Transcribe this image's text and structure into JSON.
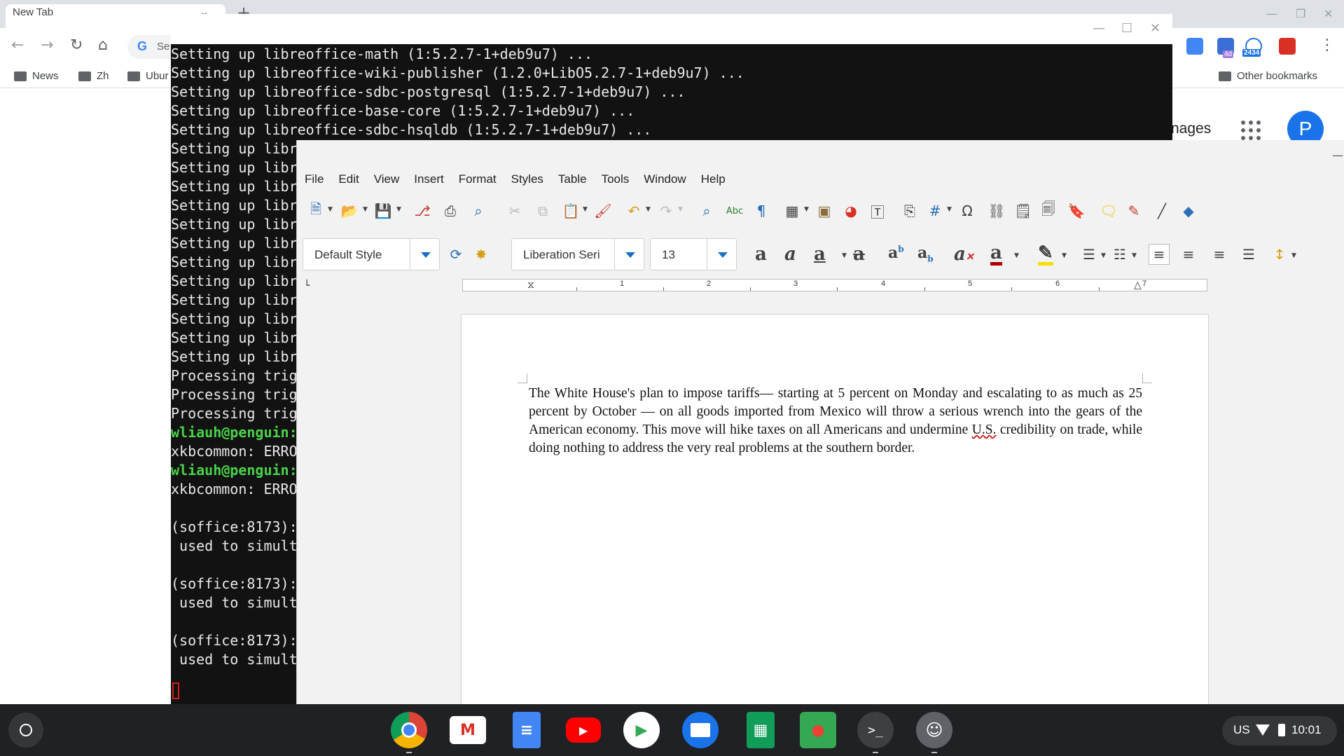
{
  "chrome": {
    "tab_title": "New Tab",
    "tab_close": "⌄",
    "new_tab": "+",
    "omnibox_placeholder": "Se",
    "omnibox_g": "G",
    "ext_badge_1": "4d",
    "ext_badge_2": "2434",
    "bookmarks": [
      "News",
      "Zh",
      "Ubur"
    ],
    "other_bookmarks": "Other bookmarks",
    "images_link": "nages",
    "avatar_letter": "P"
  },
  "terminal": {
    "lines": [
      "Setting up libreoffice-math (1:5.2.7-1+deb9u7) ...",
      "Setting up libreoffice-wiki-publisher (1.2.0+LibO5.2.7-1+deb9u7) ...",
      "Setting up libreoffice-sdbc-postgresql (1:5.2.7-1+deb9u7) ...",
      "Setting up libreoffice-base-core (1:5.2.7-1+deb9u7) ...",
      "Setting up libreoffice-sdbc-hsqldb (1:5.2.7-1+deb9u7) ...",
      "Setting up libre",
      "Setting up libre",
      "Setting up libre",
      "Setting up libre",
      "Setting up libre",
      "Setting up libre",
      "Setting up libre",
      "Setting up libre",
      "Setting up libre",
      "Setting up libre",
      "Setting up libre",
      "Setting up libre",
      "Processing trigg",
      "Processing trigg",
      "Processing trigg"
    ],
    "prompt_1": "wliauh@penguin:",
    "prompt_1_rest": "~",
    "error_1": "xkbcommon: ERROR",
    "prompt_2": "wliauh@penguin:",
    "prompt_2_rest": "~",
    "error_2": "xkbcommon: ERROR",
    "soffice_blocks": [
      {
        "line1": "(soffice:8173):",
        "line2": " used to simulta"
      },
      {
        "line1": "(soffice:8173):",
        "line2": " used to simulta"
      },
      {
        "line1": "(soffice:8173):",
        "line2": " used to simulta"
      }
    ]
  },
  "writer": {
    "menu": [
      "File",
      "Edit",
      "View",
      "Insert",
      "Format",
      "Styles",
      "Table",
      "Tools",
      "Window",
      "Help"
    ],
    "paragraph_style": "Default Style",
    "font_name": "Liberation Seri",
    "font_size": "13",
    "ruler_numbers": [
      "1",
      "2",
      "3",
      "4",
      "5",
      "6",
      "7"
    ],
    "doc_text_before": "The White House's plan to impose tariffs— starting at 5 percent on Monday and escalating to as much as 25 percent by October — on all goods imported from Mexico will throw a serious wrench into the gears of the American economy. This move will hike taxes on all Americans and undermine ",
    "doc_text_err": "U.S.",
    "doc_text_after": " credibility on trade, while doing nothing to address the very real problems at the southern border."
  },
  "shelf": {
    "status_locale": "US",
    "status_time": "10:01",
    "terminal_app_glyph": ">_"
  },
  "colors": {
    "terminal_bg": "#121212",
    "prompt_green": "#4ad24a",
    "shelf_bg": "#202124",
    "accent_blue": "#1e6fc4"
  }
}
